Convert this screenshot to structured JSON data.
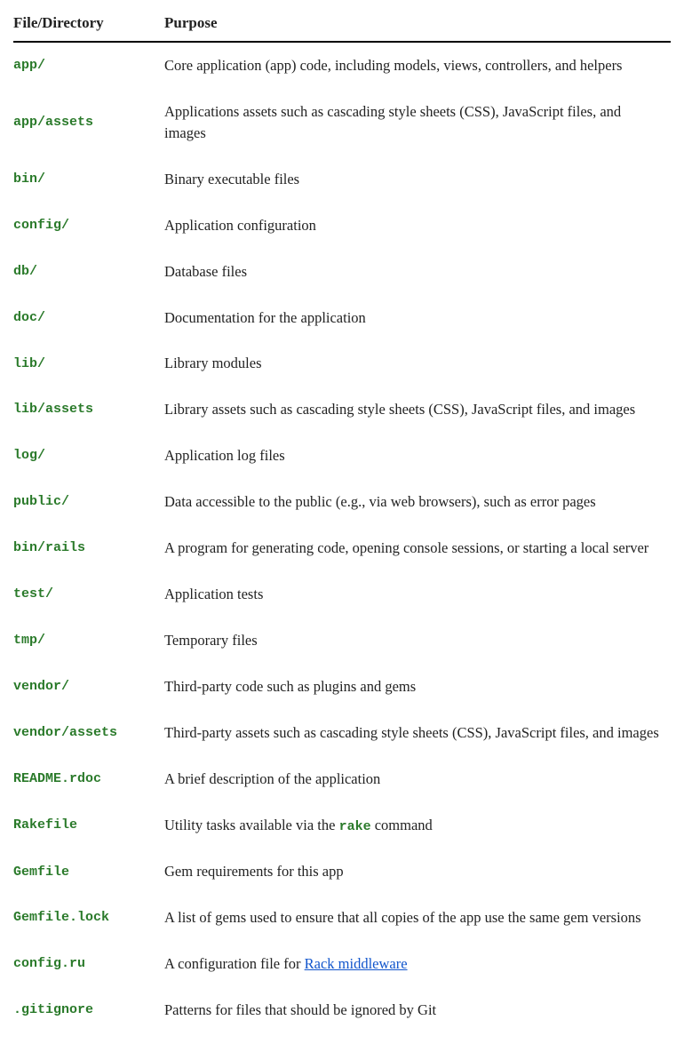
{
  "headers": {
    "file": "File/Directory",
    "purpose": "Purpose"
  },
  "rows": [
    {
      "file": "app/",
      "purpose": "Core application (app) code, including models, views, controllers, and helpers"
    },
    {
      "file": "app/assets",
      "purpose": "Applications assets such as cascading style sheets (CSS), JavaScript files, and images"
    },
    {
      "file": "bin/",
      "purpose": "Binary executable files"
    },
    {
      "file": "config/",
      "purpose": "Application configuration"
    },
    {
      "file": "db/",
      "purpose": "Database files"
    },
    {
      "file": "doc/",
      "purpose": "Documentation for the application"
    },
    {
      "file": "lib/",
      "purpose": "Library modules"
    },
    {
      "file": "lib/assets",
      "purpose": "Library assets such as cascading style sheets (CSS), JavaScript files, and images"
    },
    {
      "file": "log/",
      "purpose": "Application log files"
    },
    {
      "file": "public/",
      "purpose": "Data accessible to the public (e.g., via web browsers), such as error pages"
    },
    {
      "file": "bin/rails",
      "purpose": "A program for generating code, opening console sessions, or starting a local server"
    },
    {
      "file": "test/",
      "purpose": "Application tests"
    },
    {
      "file": "tmp/",
      "purpose": "Temporary files"
    },
    {
      "file": "vendor/",
      "purpose": "Third-party code such as plugins and gems"
    },
    {
      "file": "vendor/assets",
      "purpose": "Third-party assets such as cascading style sheets (CSS), JavaScript files, and images"
    },
    {
      "file": "README.rdoc",
      "purpose": "A brief description of the application"
    },
    {
      "file": "Rakefile",
      "purpose_pre": "Utility tasks available via the ",
      "code": "rake",
      "purpose_post": " command"
    },
    {
      "file": "Gemfile",
      "purpose": "Gem requirements for this app"
    },
    {
      "file": "Gemfile.lock",
      "purpose": "A list of gems used to ensure that all copies of the app use the same gem versions"
    },
    {
      "file": "config.ru",
      "purpose_pre": "A configuration file for ",
      "link_text": "Rack middleware"
    },
    {
      "file": ".gitignore",
      "purpose": "Patterns for files that should be ignored by Git"
    }
  ]
}
